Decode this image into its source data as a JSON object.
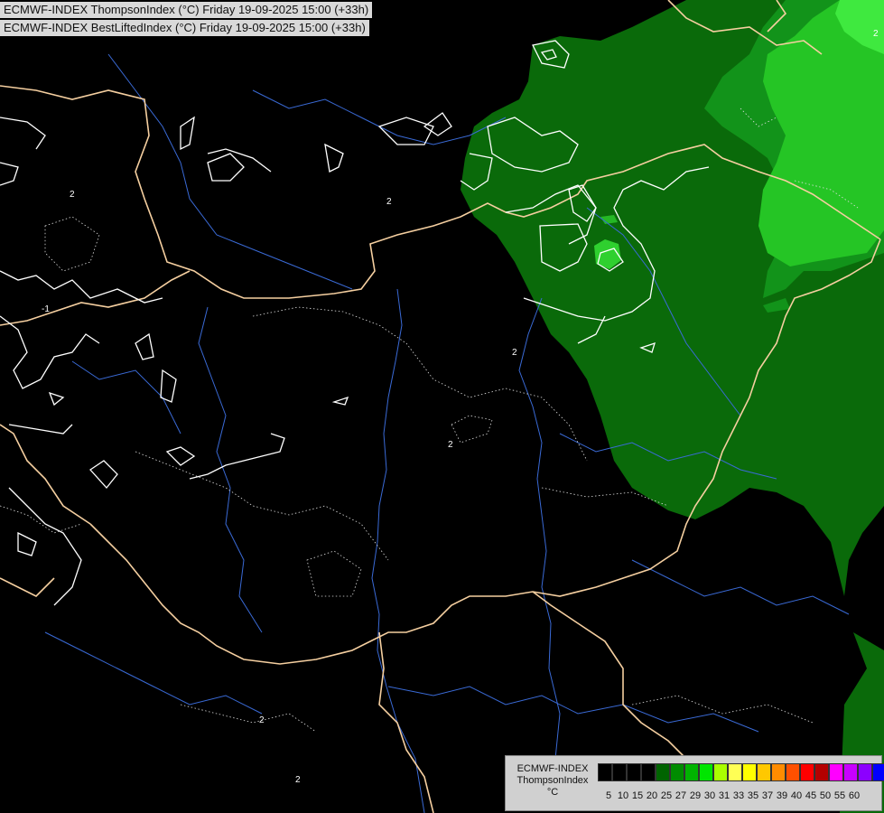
{
  "titles": {
    "line1": "ECMWF-INDEX ThompsonIndex (°C) Friday 19-09-2025 15:00 (+33h)",
    "line2": "ECMWF-INDEX BestLiftedIndex (°C) Friday 19-09-2025 15:00 (+33h)"
  },
  "legend": {
    "line1": "ECMWF-INDEX",
    "line2": "ThompsonIndex",
    "unit": "°C",
    "ticks": [
      "5",
      "10",
      "15",
      "20",
      "25",
      "27",
      "29",
      "30",
      "31",
      "33",
      "35",
      "37",
      "39",
      "40",
      "45",
      "50",
      "55",
      "60"
    ],
    "colors": [
      "#000000",
      "#000000",
      "#000000",
      "#000000",
      "#006400",
      "#008c00",
      "#00b400",
      "#00e600",
      "#aaff00",
      "#ffff55",
      "#ffff00",
      "#ffc800",
      "#ff8c00",
      "#ff5000",
      "#ff0000",
      "#b40000",
      "#ff00ff",
      "#c800ff",
      "#8c00ff",
      "#0000ff"
    ]
  },
  "map": {
    "background": "#000000",
    "field_colors": {
      "dark_green": "#0a6a0a",
      "mid_green": "#0f8c12",
      "light_green": "#22c722",
      "bright_green": "#3df03d"
    },
    "border_color": "#f5cfa0",
    "river_color": "#3a6ad6",
    "contour_color": "#ffffff",
    "contour_labels": [
      "2",
      "2",
      "-1",
      "2",
      "2",
      "2",
      "2",
      "2"
    ]
  }
}
